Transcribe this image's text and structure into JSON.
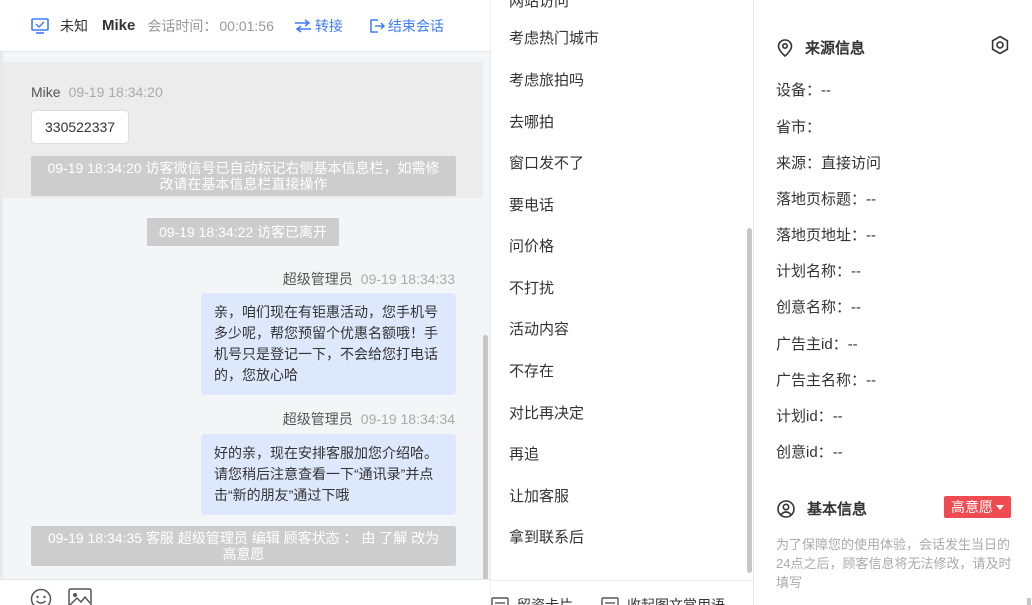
{
  "header": {
    "status": "未知",
    "visitor_name": "Mike",
    "session_time_label": "会话时间：",
    "session_time": "00:01:56",
    "transfer_label": "转接",
    "end_label": "结束会话",
    "accent": "#3f7cf5"
  },
  "messages": {
    "visitor": {
      "name": "Mike",
      "time": "09-19 18:34:20",
      "text": "330522337"
    },
    "system1": "09-19 18:34:20 访客微信号已自动标记右侧基本信息栏，如需修改请在基本信息栏直接操作",
    "system2": "09-19 18:34:22 访客已离开",
    "agent1": {
      "name": "超级管理员",
      "time": "09-19 18:34:33",
      "text": "亲，咱们现在有钜惠活动，您手机号多少呢，帮您预留个优惠名额哦！手机号只是登记一下，不会给您打电话的，您放心哈"
    },
    "agent2": {
      "name": "超级管理员",
      "time": "09-19 18:34:34",
      "text": "好的亲，现在安排客服加您介绍哈。请您稍后注意查看一下“通讯录”并点击“新的朋友”通过下哦"
    },
    "system3": "09-19 18:34:35 客服 超级管理员 编辑 顾客状态 ： 由 了解 改为 高意愿",
    "agent_bubble_color": "#dde8fd"
  },
  "toolbar": {
    "emoji_icon": "smile-icon",
    "image_icon": "image-icon"
  },
  "quick_replies": {
    "partial_top": "网站访问",
    "items": [
      "考虑热门城市",
      "考虑旅拍吗",
      "去哪拍",
      "窗口发不了",
      "要电话",
      "问价格",
      "不打扰",
      "活动内容",
      "不存在",
      "对比再决定",
      "再追",
      "让加客服",
      "拿到联系后"
    ],
    "bottom": {
      "card_label": "留资卡片",
      "collect_label": "收起图文常用语"
    }
  },
  "info": {
    "source_title": "来源信息",
    "fields": [
      {
        "label": "设备：",
        "value": "--"
      },
      {
        "label": "省市：",
        "value": ""
      },
      {
        "label": "来源：",
        "value": "直接访问"
      },
      {
        "label": "落地页标题：",
        "value": "--"
      },
      {
        "label": "落地页地址：",
        "value": "--"
      },
      {
        "label": "计划名称：",
        "value": "--"
      },
      {
        "label": "创意名称：",
        "value": "--"
      },
      {
        "label": "广告主id：",
        "value": "--"
      },
      {
        "label": "广告主名称：",
        "value": "--"
      },
      {
        "label": "计划id：",
        "value": "--"
      },
      {
        "label": "创意id：",
        "value": "--"
      }
    ],
    "basic_title": "基本信息",
    "intent_badge": "高意愿",
    "badge_color": "#f04b50",
    "notice": "为了保障您的使用体验，会话发生当日的24点之后，顾客信息将无法修改，请及时填写"
  }
}
